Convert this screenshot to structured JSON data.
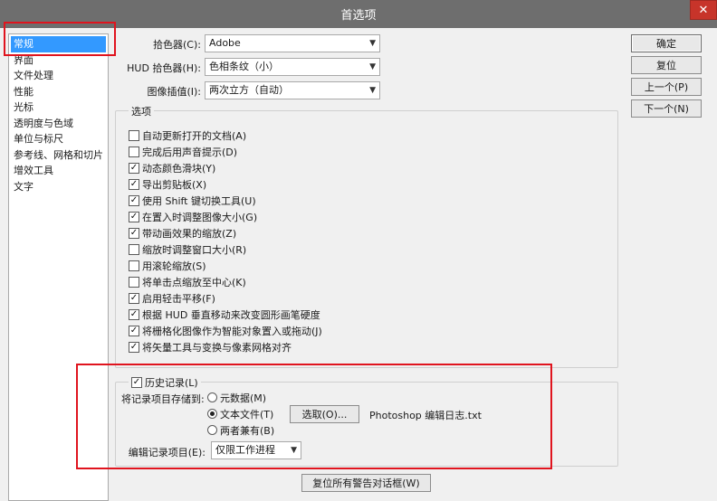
{
  "window": {
    "title": "首选项",
    "close_glyph": "✕"
  },
  "sidebar": {
    "items": [
      {
        "label": "常规"
      },
      {
        "label": "界面"
      },
      {
        "label": "文件处理"
      },
      {
        "label": "性能"
      },
      {
        "label": "光标"
      },
      {
        "label": "透明度与色域"
      },
      {
        "label": "单位与标尺"
      },
      {
        "label": "参考线、网格和切片"
      },
      {
        "label": "增效工具"
      },
      {
        "label": "文字"
      }
    ]
  },
  "pickers": {
    "color_picker": {
      "label": "拾色器(C):",
      "value": "Adobe"
    },
    "hud_picker": {
      "label": "HUD 拾色器(H):",
      "value": "色相条纹（小）"
    },
    "interpolation": {
      "label": "图像插值(I):",
      "value": "两次立方（自动）"
    }
  },
  "options": {
    "title": "选项",
    "items": [
      {
        "label": "自动更新打开的文档(A)",
        "checked": false
      },
      {
        "label": "完成后用声音提示(D)",
        "checked": false
      },
      {
        "label": "动态颜色滑块(Y)",
        "checked": true
      },
      {
        "label": "导出剪贴板(X)",
        "checked": true
      },
      {
        "label": "使用 Shift 键切换工具(U)",
        "checked": true
      },
      {
        "label": "在置入时调整图像大小(G)",
        "checked": true
      },
      {
        "label": "带动画效果的缩放(Z)",
        "checked": true
      },
      {
        "label": "缩放时调整窗口大小(R)",
        "checked": false
      },
      {
        "label": "用滚轮缩放(S)",
        "checked": false
      },
      {
        "label": "将单击点缩放至中心(K)",
        "checked": false
      },
      {
        "label": "启用轻击平移(F)",
        "checked": true
      },
      {
        "label": "根据 HUD 垂直移动来改变圆形画笔硬度",
        "checked": true
      },
      {
        "label": "将栅格化图像作为智能对象置入或拖动(J)",
        "checked": true
      },
      {
        "label": "将矢量工具与变换与像素网格对齐",
        "checked": true
      }
    ]
  },
  "history": {
    "title": "历史记录(L)",
    "checked": true,
    "save_to_label": "将记录项目存储到:",
    "radios": [
      {
        "label": "元数据(M)",
        "selected": false
      },
      {
        "label": "文本文件(T)",
        "selected": true
      },
      {
        "label": "两者兼有(B)",
        "selected": false
      }
    ],
    "choose_button": "选取(O)...",
    "file_name": "Photoshop 编辑日志.txt",
    "edit_log_label": "编辑记录项目(E):",
    "edit_log_value": "仅限工作进程"
  },
  "buttons": {
    "ok": "确定",
    "reset": "复位",
    "prev": "上一个(P)",
    "next": "下一个(N)",
    "reset_warnings": "复位所有警告对话框(W)"
  },
  "glyphs": {
    "check": "✓",
    "dropdown": "▼"
  }
}
